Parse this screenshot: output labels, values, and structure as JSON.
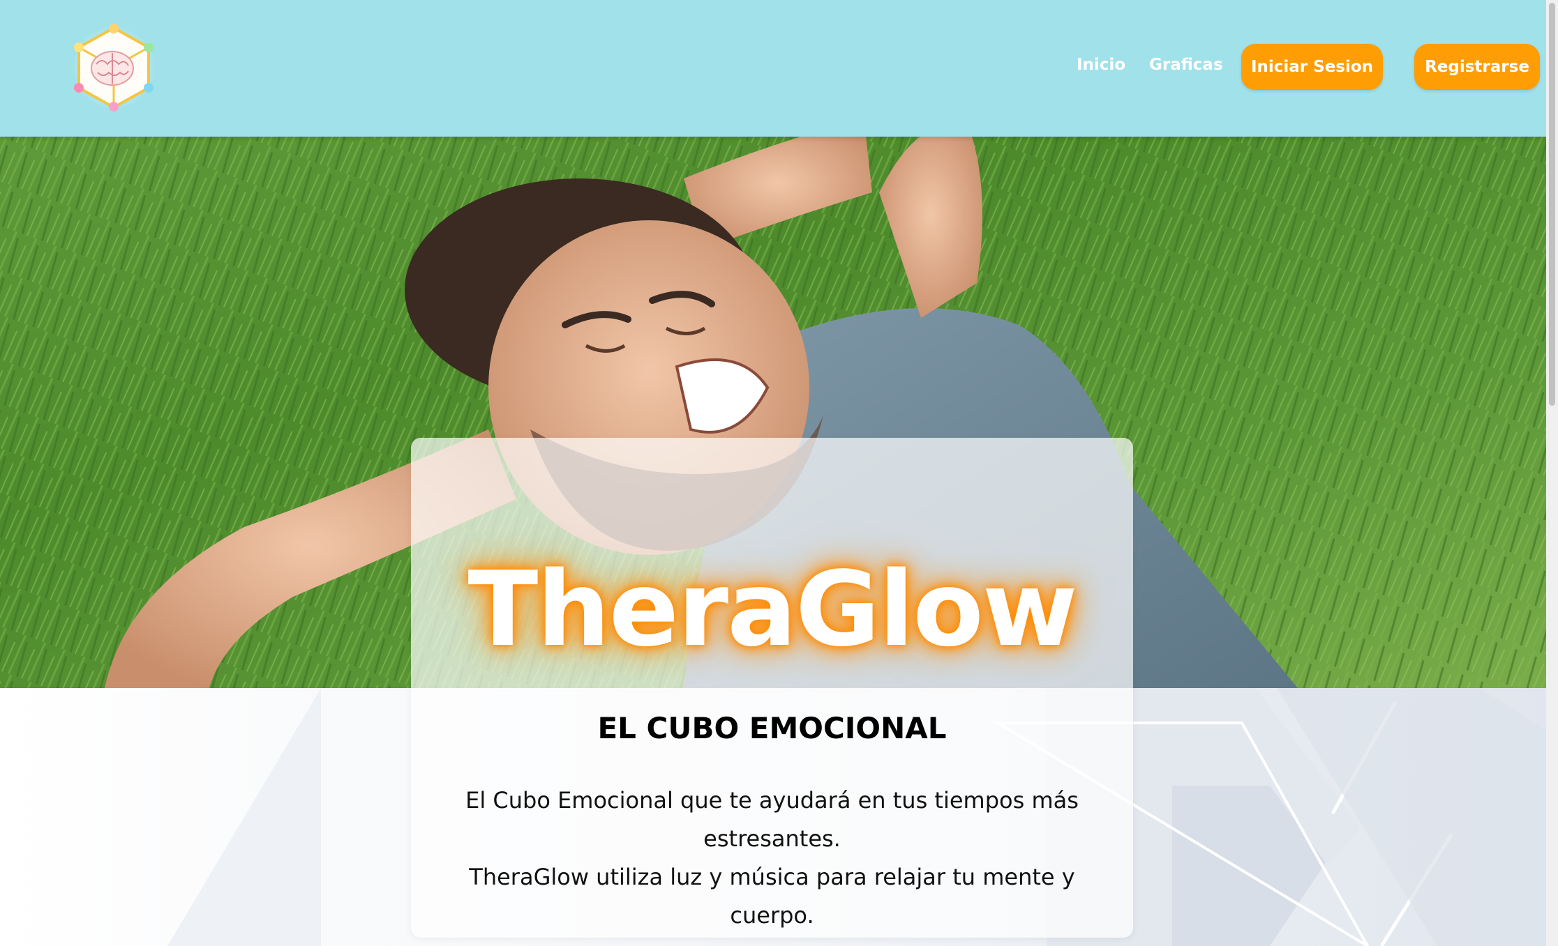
{
  "nav": {
    "links": [
      "Inicio",
      "Graficas"
    ],
    "login_label": "Iniciar Sesion",
    "register_label": "Registrarse",
    "accent_color": "#ff9d05",
    "header_color": "#a1e1ea"
  },
  "hero": {
    "brand": "TheraGlow",
    "subtitle": "EL CUBO EMOCIONAL",
    "description_line1": "El Cubo Emocional que te ayudará en tus tiempos más estresantes.",
    "description_line2": "TheraGlow utiliza luz y música para relajar tu mente y cuerpo.",
    "glow_color": "#ff8a00"
  },
  "icons": {
    "logo": "brain-cube-logo"
  }
}
